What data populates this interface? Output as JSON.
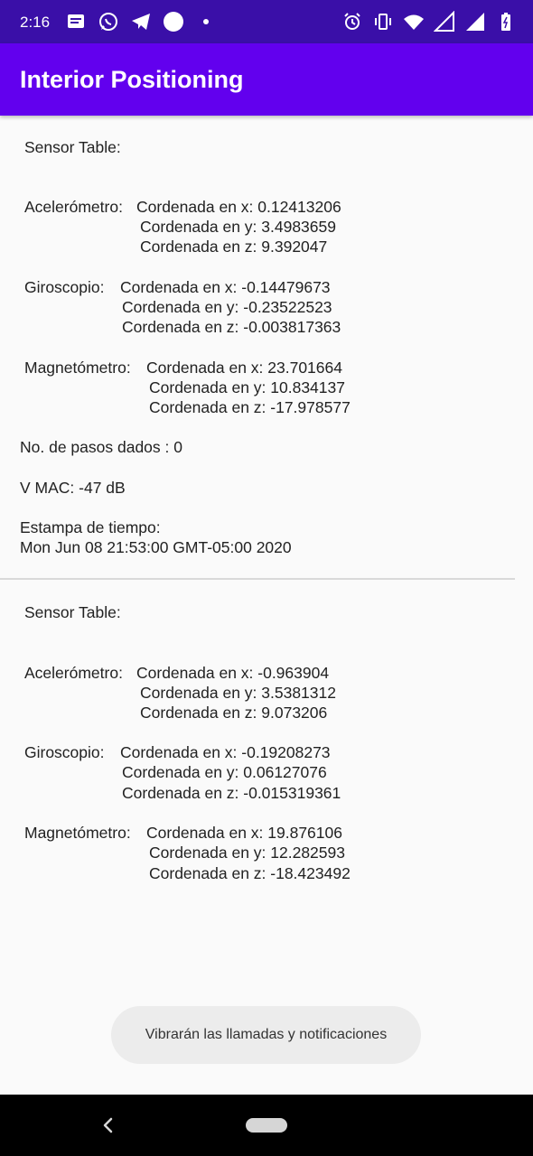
{
  "status_bar": {
    "time": "2:16",
    "icons_left": [
      "message-icon",
      "whatsapp-icon",
      "telegram-icon",
      "circle-icon",
      "dot-icon"
    ],
    "icons_right": [
      "alarm-icon",
      "vibrate-icon",
      "wifi-icon",
      "signal-icon",
      "signal-icon",
      "battery-icon"
    ]
  },
  "app_bar": {
    "title": "Interior Positioning"
  },
  "records": [
    {
      "header": "Sensor Table:",
      "acc_label": "Acelerómetro:",
      "acc_x": "Cordenada en x: 0.12413206",
      "acc_y": "Cordenada en y: 3.4983659",
      "acc_z": "Cordenada en z: 9.392047",
      "gyro_label": "Giroscopio:",
      "gyro_x": "Cordenada en x: -0.14479673",
      "gyro_y": "Cordenada en y: -0.23522523",
      "gyro_z": "Cordenada en z: -0.003817363",
      "mag_label": "Magnetómetro:",
      "mag_x": "Cordenada en x: 23.701664",
      "mag_y": "Cordenada en y: 10.834137",
      "mag_z": "Cordenada en z: -17.978577",
      "steps": "No. de pasos dados : 0",
      "mac": "V MAC: -47 dB",
      "timestamp_label": "Estampa de tiempo:",
      "timestamp": "Mon Jun 08 21:53:00 GMT-05:00 2020"
    },
    {
      "header": "Sensor Table:",
      "acc_label": "Acelerómetro:",
      "acc_x": "Cordenada en x: -0.963904",
      "acc_y": "Cordenada en y: 3.5381312",
      "acc_z": "Cordenada en z: 9.073206",
      "gyro_label": "Giroscopio:",
      "gyro_x": "Cordenada en x: -0.19208273",
      "gyro_y": "Cordenada en y: 0.06127076",
      "gyro_z": "Cordenada en z: -0.015319361",
      "mag_label": "Magnetómetro:",
      "mag_x": "Cordenada en x: 19.876106",
      "mag_y": "Cordenada en y: 12.282593",
      "mag_z": "Cordenada en z: -18.423492"
    }
  ],
  "toast": {
    "text": "Vibrarán las llamadas y notificaciones"
  },
  "nav_bar": {
    "icons": [
      "back-icon",
      "home-pill-icon"
    ]
  }
}
